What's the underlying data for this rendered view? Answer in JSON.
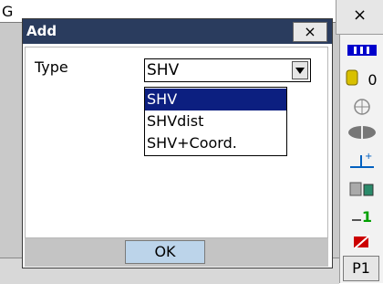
{
  "background_window": {
    "title_partial": "G",
    "close_label": "×"
  },
  "dialog": {
    "title": "Add",
    "close_label": "×",
    "type_label": "Type",
    "select_value": "SHV",
    "options": [
      "SHV",
      "SHVdist",
      "SHV+Coord."
    ],
    "ok_label": "OK",
    "colors": {
      "titlebar": "#2a3c5e",
      "selected": "#0c1f80",
      "ok_button": "#bcd4ea"
    }
  },
  "sidebar": {
    "memory_count": "0",
    "prism_constant": "1",
    "page_label": "P1",
    "icons": [
      "battery-icon",
      "memory-icon",
      "tilt-icon",
      "target-icon",
      "instrument-height-icon",
      "device-icon",
      "prism-icon",
      "pen-icon"
    ]
  }
}
